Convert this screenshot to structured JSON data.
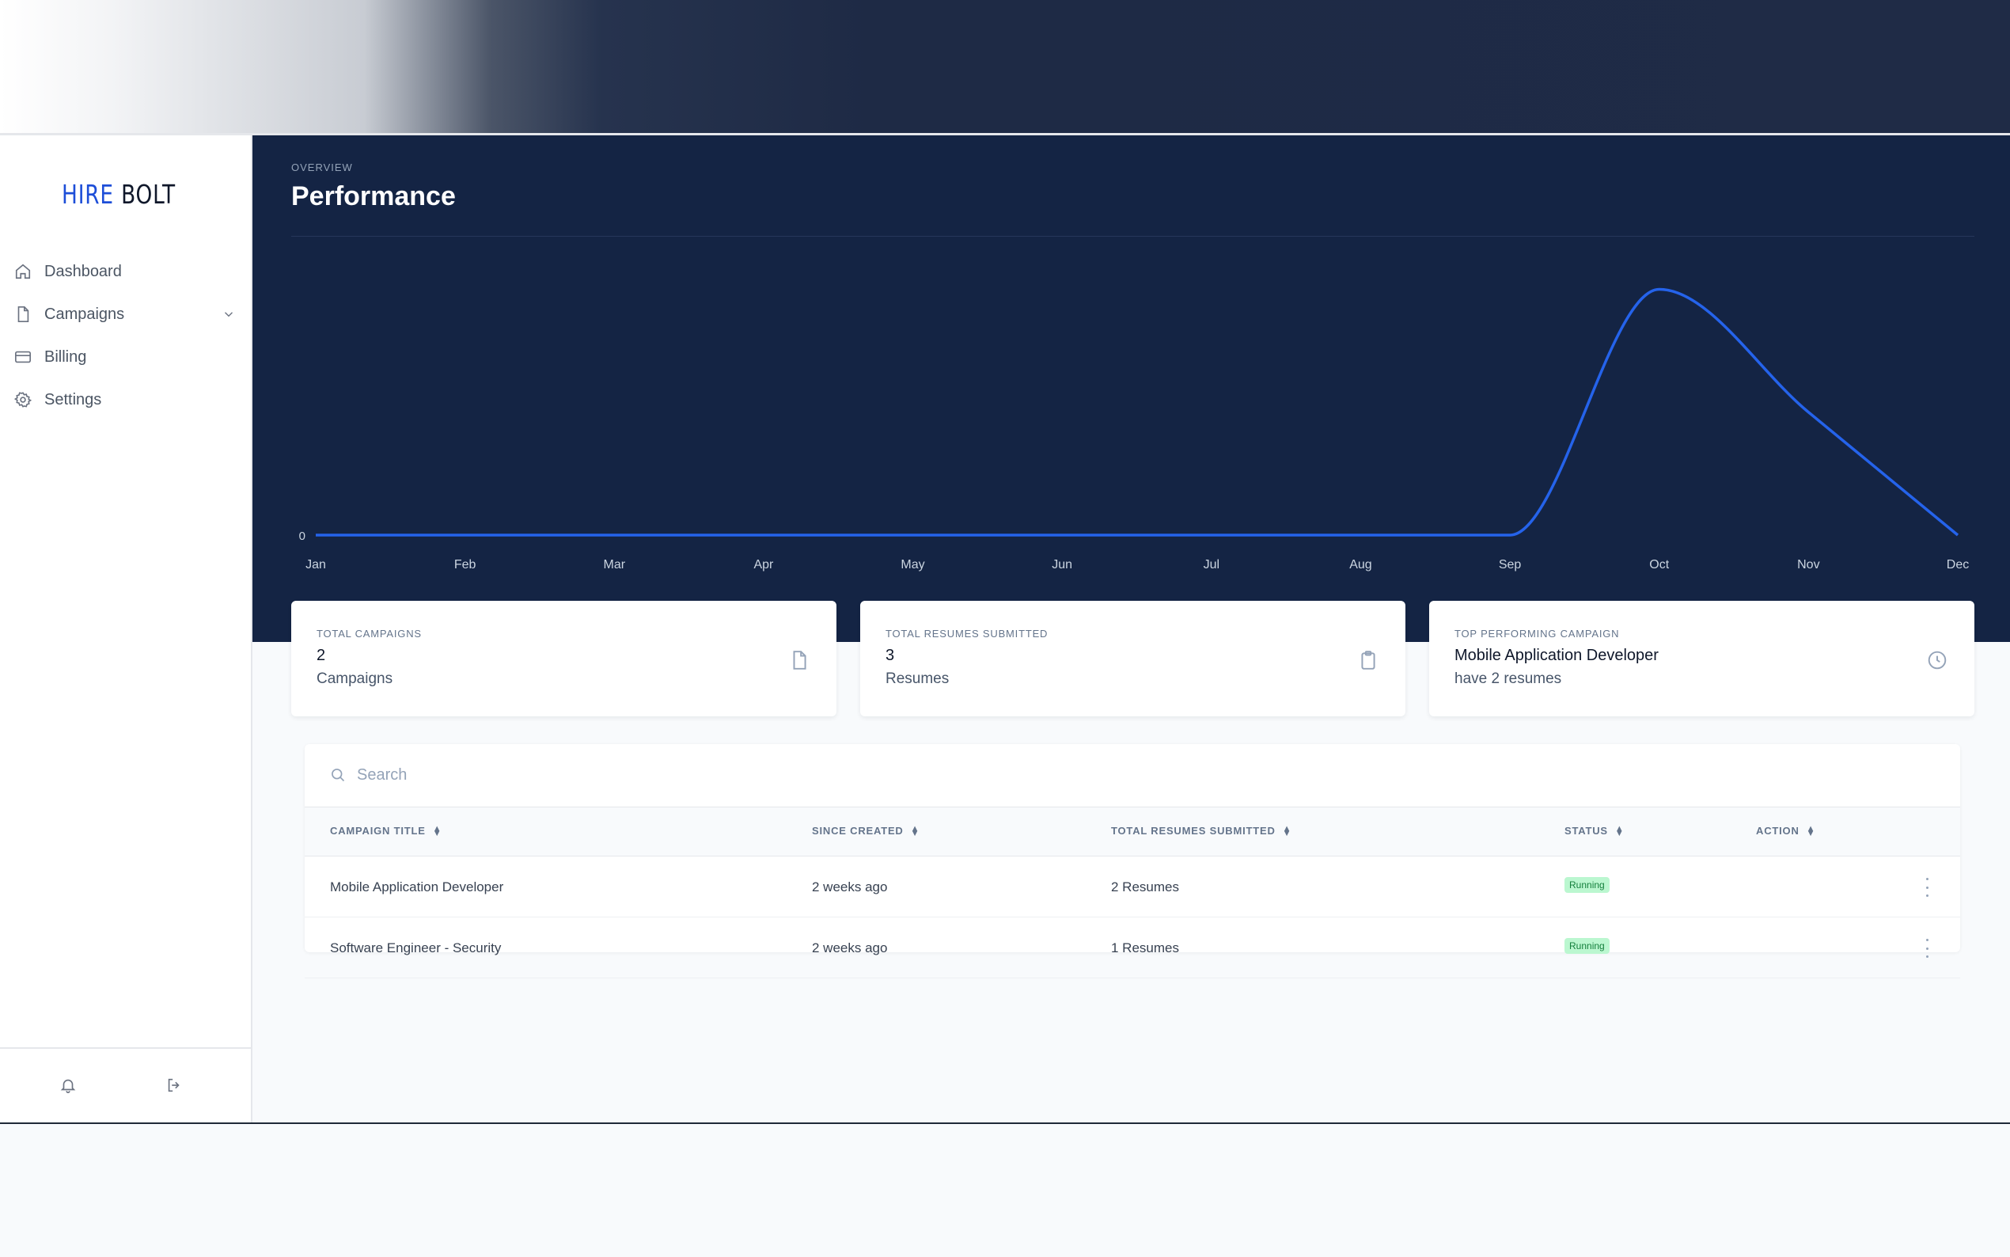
{
  "brand": {
    "part1": "HIRE",
    "part2": "BOLT"
  },
  "sidebar": {
    "items": [
      {
        "label": "Dashboard",
        "icon": "home-icon"
      },
      {
        "label": "Campaigns",
        "icon": "document-icon"
      },
      {
        "label": "Billing",
        "icon": "credit-card-icon"
      },
      {
        "label": "Settings",
        "icon": "gear-icon"
      }
    ],
    "bottom_icons": [
      "bell-icon",
      "logout-icon"
    ]
  },
  "header": {
    "overline": "OVERVIEW",
    "title": "Performance"
  },
  "chart_data": {
    "type": "line",
    "categories": [
      "Jan",
      "Feb",
      "Mar",
      "Apr",
      "May",
      "Jun",
      "Jul",
      "Aug",
      "Sep",
      "Oct",
      "Nov",
      "Dec"
    ],
    "series": [
      {
        "values": [
          0,
          0,
          0,
          0,
          0,
          0,
          0,
          0,
          0,
          2,
          1,
          0
        ]
      }
    ],
    "y_ticks": [
      0
    ],
    "ylim": [
      0,
      2.1
    ],
    "line_color": "#2563eb",
    "grid": false
  },
  "stats": [
    {
      "label": "TOTAL CAMPAIGNS",
      "value": "2",
      "sub": "Campaigns",
      "icon": "document-icon"
    },
    {
      "label": "TOTAL RESUMES SUBMITTED",
      "value": "3",
      "sub": "Resumes",
      "icon": "clipboard-icon"
    },
    {
      "label": "TOP PERFORMING CAMPAIGN",
      "value": "Mobile Application Developer",
      "sub": "have 2 resumes",
      "icon": "clock-icon"
    }
  ],
  "table": {
    "search_placeholder": "Search",
    "columns": [
      "CAMPAIGN TITLE",
      "SINCE CREATED",
      "TOTAL RESUMES SUBMITTED",
      "STATUS",
      "ACTION"
    ],
    "rows": [
      {
        "title": "Mobile Application Developer",
        "since": "2 weeks ago",
        "resumes": "2 Resumes",
        "status": "Running"
      },
      {
        "title": "Software Engineer - Security",
        "since": "2 weeks ago",
        "resumes": "1 Resumes",
        "status": "Running"
      }
    ]
  },
  "colors": {
    "hero_bg": "#142444",
    "accent": "#2563eb",
    "status_running_bg": "#bbf7d0",
    "status_running_text": "#15803d"
  }
}
